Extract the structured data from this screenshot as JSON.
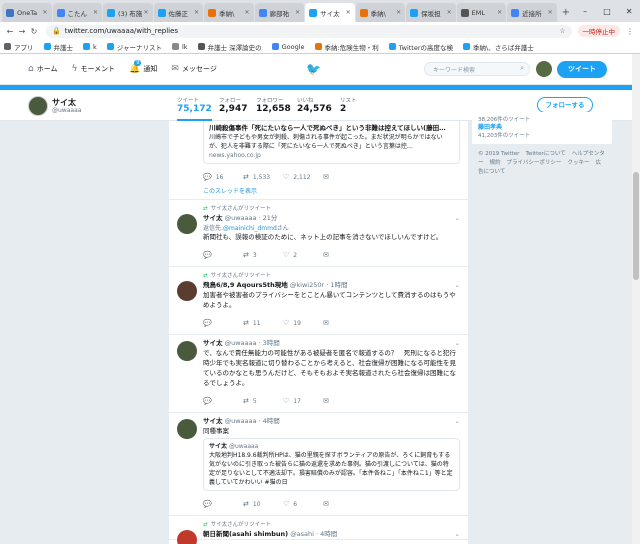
{
  "browser": {
    "tabs": [
      {
        "label": "OneTa",
        "color": "#3d76c4"
      },
      {
        "label": "こたん",
        "color": "#4285f4"
      },
      {
        "label": "(3) 布施",
        "color": "#1da1f2"
      },
      {
        "label": "佐藤正",
        "color": "#1da1f2"
      },
      {
        "label": "季納\\",
        "color": "#e8710a"
      },
      {
        "label": "廊部祐",
        "color": "#4285f4"
      },
      {
        "label": "サイ太",
        "color": "#1da1f2",
        "active": true
      },
      {
        "label": "季納\\",
        "color": "#e8710a"
      },
      {
        "label": "保坂担",
        "color": "#1da1f2"
      },
      {
        "label": "EML",
        "color": "#555555"
      },
      {
        "label": "近接所",
        "color": "#4285f4"
      }
    ],
    "url": "twitter.com/uwaaaa/with_replies",
    "pause_label": "一時停止中",
    "bookmarks": [
      {
        "label": "アプリ",
        "color": "#5f6368"
      },
      {
        "label": "弁護士",
        "color": "#1da1f2"
      },
      {
        "label": "k",
        "color": "#1da1f2"
      },
      {
        "label": "ジャーナリスト",
        "color": "#1da1f2"
      },
      {
        "label": "lk",
        "color": "#888888"
      },
      {
        "label": "弁護士 深澤論史の",
        "color": "#555555"
      },
      {
        "label": "Google",
        "color": "#4285f4"
      },
      {
        "label": "季納:危険生物・利",
        "color": "#e8710a"
      },
      {
        "label": "Twitterの高度な検",
        "color": "#1da1f2"
      },
      {
        "label": "季納\\、さらば弁護士",
        "color": "#1da1f2"
      }
    ]
  },
  "twitter_nav": {
    "home": "ホーム",
    "moments": "モーメント",
    "notifications": "通知",
    "notification_count": "9",
    "messages": "メッセージ",
    "search_placeholder": "キーワード検索",
    "tweet_button": "ツイート"
  },
  "profile": {
    "name": "サイ太",
    "handle": "@uwaaaa",
    "stats": [
      {
        "label": "ツイート",
        "value": "75,172"
      },
      {
        "label": "フォロー",
        "value": "2,947"
      },
      {
        "label": "フォロワー",
        "value": "12,658"
      },
      {
        "label": "いいね",
        "value": "24,576"
      },
      {
        "label": "リスト",
        "value": "2"
      }
    ],
    "follow_button": "フォローする"
  },
  "timeline": {
    "top_quote": {
      "title": "川崎殺傷事件「死にたいなら一人で死ぬべき」という非難は控えてほしい(藤田…",
      "body": "川崎市で子どもや男女が刺殺、刺傷される事件が起こった。まだ状況が明らかではないが、犯人を非難する際に「死にたいなら一人で死ぬべき」という言葉は控…",
      "source": "news.yahoo.co.jp",
      "replies": "16",
      "retweets": "1,533",
      "likes": "2,112",
      "thread_link": "このスレッドを表示"
    },
    "tweets": [
      {
        "retweet_label": "サイ太さんがリツイート",
        "name": "サイ太",
        "handle": "@uwaaaa · 21分",
        "reply_prefix": "返信先:",
        "reply_to": "@mainichi_dmmd",
        "reply_suffix": "さん",
        "text": "新聞社も、誤報の検証のために、ネット上の記事を消さないでほしいんですけど。",
        "replies": "",
        "retweets": "3",
        "likes": "2"
      },
      {
        "retweet_label": "サイ太さんがリツイート",
        "name": "飛鳥6/8,9 Aqours5th現地",
        "handle": "@kiwi250r · 1時間",
        "text": "加害者や被害者のプライバシーをとことん暴いてコンテンツとして費消するのはもうやめようよ。",
        "replies": "",
        "retweets": "11",
        "likes": "19"
      },
      {
        "retweet_label": "",
        "name": "サイ太",
        "handle": "@uwaaaa · 3時間",
        "text": "で、なんで責任無能力の可能性がある被疑者を匿名で報道するの？　死刑になると犯行時少年でも実名報道に切り替わることから考えると、社会復帰が困難になる可能性を見ているのかなとも思うんだけど、そもそもおよそ実名報道されたら社会復帰は困難になるでしょうよ。",
        "replies": "",
        "retweets": "5",
        "likes": "17"
      },
      {
        "retweet_label": "",
        "name": "サイ太",
        "handle": "@uwaaaa · 4時間",
        "text": "同種事案",
        "quote_name": "サイ太",
        "quote_handle": "@uwaaaa",
        "quote_text": "大阪地判H18.9.6裁判所HPは、猫の里親を探すボランティアの原告が、ろくに飼育もする気がないのに引き取った被告らに猫の返還を求めた事例。猫の引渡しについては、猫の特定が足りないとして不適法却下。損害賠償のみが認容。「本件各ねこ」「本件ねこ1」等と定義していてかわいい #猫の日",
        "replies": "",
        "retweets": "10",
        "likes": "6"
      },
      {
        "retweet_label": "サイ太さんがリツイート",
        "name": "朝日新聞(asahi shimbun)",
        "handle": "@asahi · 4時間",
        "text": ""
      }
    ]
  },
  "sidebar": {
    "count1": "38,206件のツイート",
    "trend": "藤田孝典",
    "count2": "41,203件のツイート",
    "footer": [
      "© 2019 Twitter",
      "Twitterについて",
      "ヘルプセンター",
      "規約",
      "プライバシーポリシー",
      "クッキー",
      "広告について"
    ]
  },
  "colors": {
    "accent": "#1da1f2",
    "retweet": "#17bf63"
  }
}
